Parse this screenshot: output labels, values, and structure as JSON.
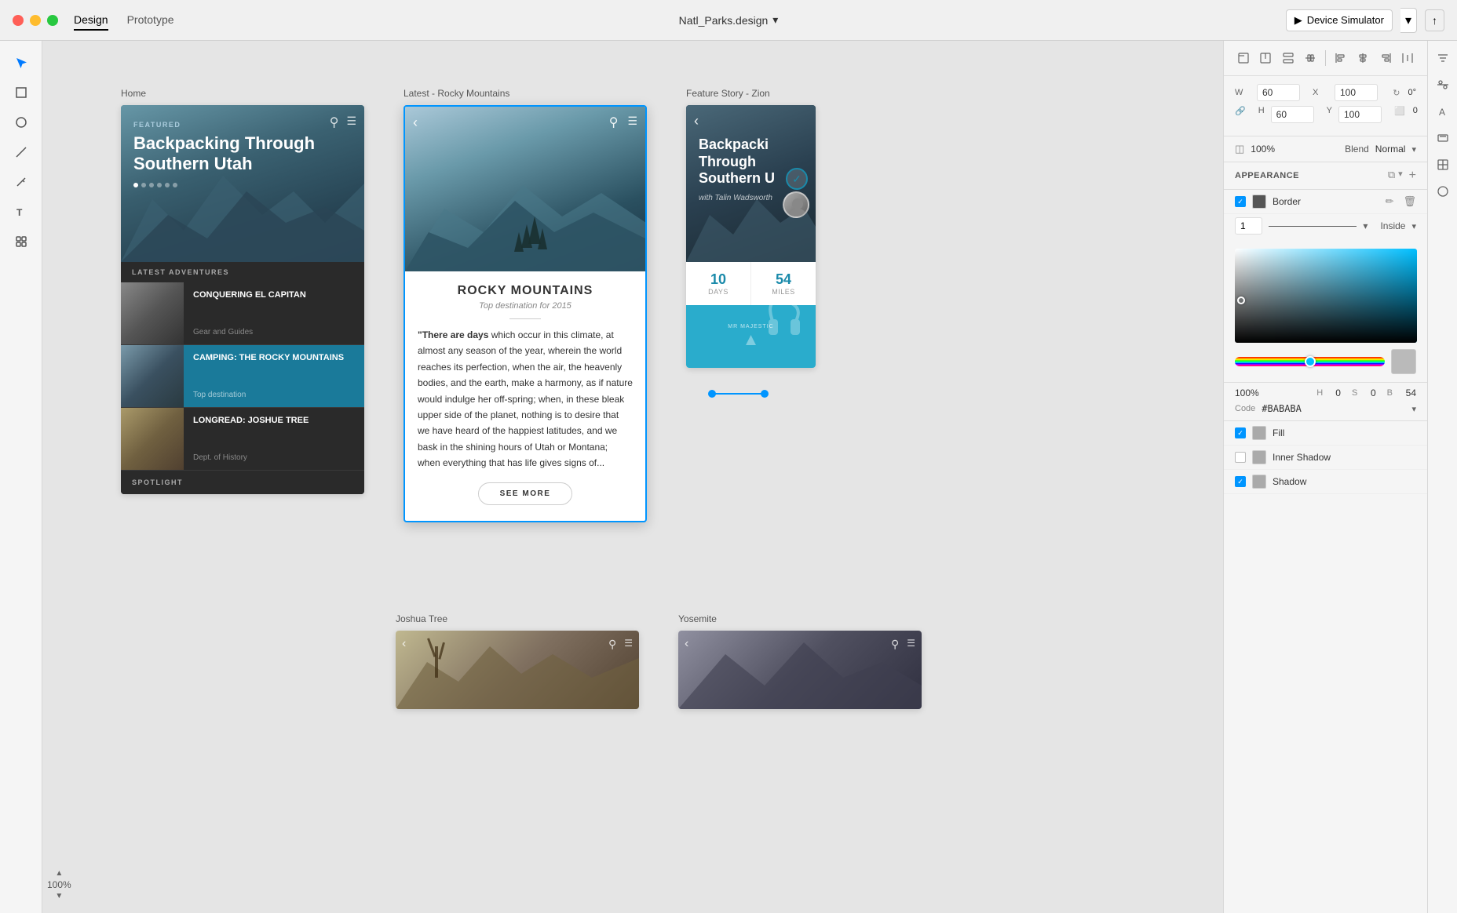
{
  "titlebar": {
    "tabs": [
      "Design",
      "Prototype"
    ],
    "active_tab": "Design",
    "file_name": "Natl_Parks.design",
    "device_simulator": "Device Simulator",
    "dropdown_arrow": "▾",
    "share_icon": "↑"
  },
  "left_toolbar": {
    "tools": [
      "cursor",
      "rectangle",
      "circle",
      "line",
      "pen",
      "text",
      "component"
    ]
  },
  "canvas": {
    "frames": [
      {
        "id": "home",
        "label": "Home",
        "hero_tag": "FEATURED",
        "hero_title": "Backpacking Through Southern Utah",
        "section_label": "LATEST ADVENTURES",
        "adventures": [
          {
            "title": "CONQUERING EL CAPITAN",
            "sub": "Gear and Guides",
            "style": "yosemite"
          },
          {
            "title": "CAMPING: THE ROCKY MOUNTAINS",
            "sub": "Top destination",
            "style": "rocky",
            "highlighted": true
          },
          {
            "title": "LONGREAD: JOSHUE TREE",
            "sub": "Dept. of History",
            "style": "joshua"
          }
        ]
      },
      {
        "id": "rocky",
        "label": "Latest - Rocky Mountains",
        "article_title": "ROCKY MOUNTAINS",
        "article_subtitle": "Top destination for 2015",
        "article_quote": "“There are days which occur in this climate, at almost any season of the year, wherein the world reaches its perfection, when the air, the heavenly bodies, and the earth, make a harmony, as if nature would indulge her off-spring; when, in these bleak upper side of the planet, nothing is to desire that we have heard of the happiest latitudes, and we bask in the shining hours of Utah or Montana; when everything that has life gives signs of...",
        "see_more": "SEE MORE"
      },
      {
        "id": "zion",
        "label": "Feature Story - Zion",
        "hero_title": "Backpacking Through Southern U",
        "hero_author": "with Talin Wadsworth",
        "stat1_num": "10",
        "stat1_label": "DAYS",
        "stat2_num": "54",
        "stat2_label": "MILES"
      }
    ],
    "bottom_frames": [
      {
        "label": "Joshua Tree",
        "style": "joshua"
      },
      {
        "label": "Yosemite",
        "style": "yosemite"
      }
    ]
  },
  "right_panel": {
    "align_icons": [
      "align-top-left",
      "align-top-center",
      "align-top-right",
      "align-top-full",
      "align-v-left",
      "align-v-center",
      "align-v-right",
      "align-v-full"
    ],
    "dimensions": {
      "w_label": "W",
      "w_value": "60",
      "x_label": "X",
      "x_value": "100",
      "rotate_label": "0°",
      "h_label": "H",
      "h_value": "60",
      "y_label": "Y",
      "y_value": "100",
      "corners_value": "0"
    },
    "opacity": {
      "value": "100%",
      "blend_label": "Blend",
      "blend_value": "Normal"
    },
    "appearance": {
      "title": "APPEARANCE",
      "effects": [
        {
          "label": "Border",
          "checked": true,
          "has_swatch": true,
          "swatch_color": "#555555"
        },
        {
          "label": "Inner Shadow",
          "checked": false,
          "has_swatch": true,
          "swatch_color": "#555555"
        },
        {
          "label": "Shadow",
          "checked": true,
          "has_swatch": true,
          "swatch_color": "#555555"
        }
      ],
      "border_thickness": "1",
      "border_position": "Inside"
    },
    "color_picker": {
      "h": "0",
      "s": "0",
      "b": "54",
      "opacity": "100%",
      "code_label": "Code",
      "code_value": "#BABABA"
    }
  },
  "zoom": {
    "value": "100%"
  }
}
